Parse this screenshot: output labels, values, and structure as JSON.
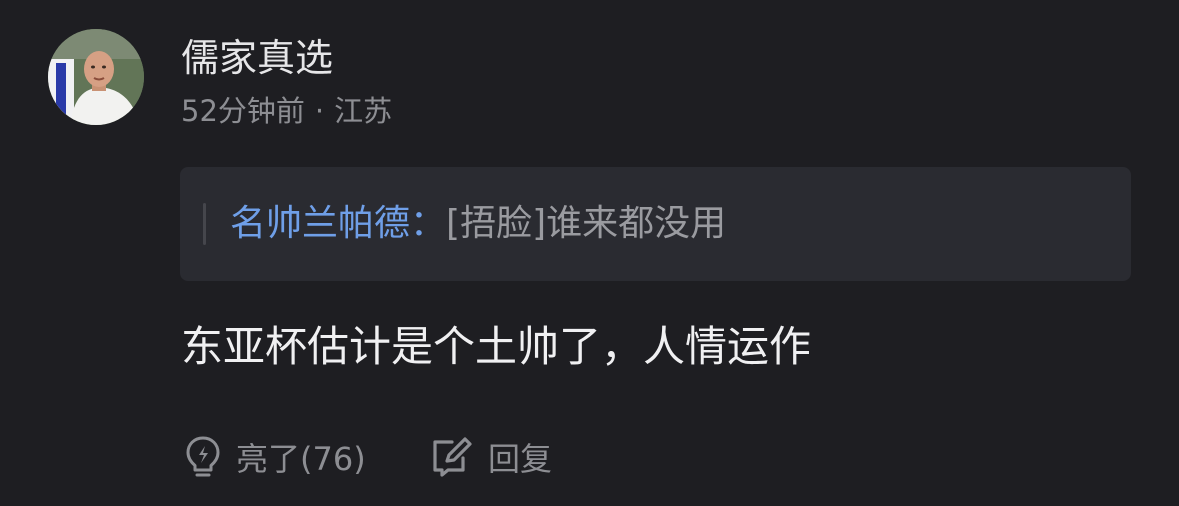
{
  "comment": {
    "username": "儒家真选",
    "time": "52分钟前",
    "separator": "·",
    "location": "江苏",
    "quote": {
      "author": "名帅兰帕德",
      "colon": "：",
      "text": "[捂脸]谁来都没用"
    },
    "content": "东亚杯估计是个土帅了，人情运作",
    "actions": {
      "like_label": "亮了(76)",
      "reply_label": "回复"
    }
  },
  "icons": {
    "like": "lightbulb-icon",
    "reply": "edit-reply-icon"
  },
  "colors": {
    "background": "#1e1e22",
    "quote_background": "#2a2b31",
    "quote_author": "#6f9fe8",
    "muted_text": "#8d8e93"
  }
}
